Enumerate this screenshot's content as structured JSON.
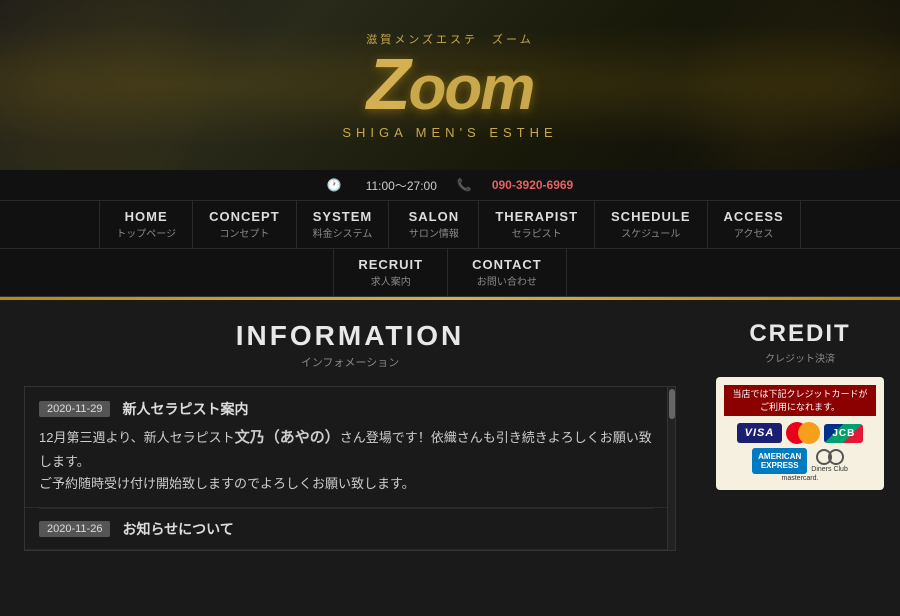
{
  "header": {
    "subtitle": "滋賀メンズエステ　ズーム",
    "logo": "Zoom",
    "tagline": "SHIGA MEN'S ESTHE"
  },
  "infobar": {
    "hours": "11:00～27:00",
    "phone": "090-3920-6969"
  },
  "nav": {
    "row1": [
      {
        "en": "HOME",
        "jp": "トップページ"
      },
      {
        "en": "CONCEPT",
        "jp": "コンセプト"
      },
      {
        "en": "SYSTEM",
        "jp": "料金システム"
      },
      {
        "en": "SALON",
        "jp": "サロン情報"
      },
      {
        "en": "THERAPIST",
        "jp": "セラピスト"
      },
      {
        "en": "SCHEDULE",
        "jp": "スケジュール"
      },
      {
        "en": "ACCESS",
        "jp": "アクセス"
      }
    ],
    "row2": [
      {
        "en": "RECRUIT",
        "jp": "求人案内"
      },
      {
        "en": "CONTACT",
        "jp": "お問い合わせ"
      }
    ]
  },
  "main": {
    "title_en": "INFORMATION",
    "title_jp": "インフォメーション",
    "items": [
      {
        "date": "2020-11-29",
        "title": "新人セラピスト案内",
        "body_prefix": "12月第三週より、新人セラピスト",
        "body_highlight": "文乃（あやの）",
        "body_suffix": "さん登場です！依織さんも引き続きよろしくお願い致します。\nご予約随時受け付け開始致しますのでよろしくお願い致します。"
      },
      {
        "date": "2020-11-26",
        "title": "お知らせについて"
      }
    ]
  },
  "sidebar": {
    "title_en": "CREDIT",
    "title_jp": "クレジット決済",
    "credit_header": "当店では下記クレジットカードがご利用になれます。",
    "cards": [
      "VISA",
      "Mastercard",
      "JCB",
      "AMEX",
      "Diners Club"
    ]
  }
}
